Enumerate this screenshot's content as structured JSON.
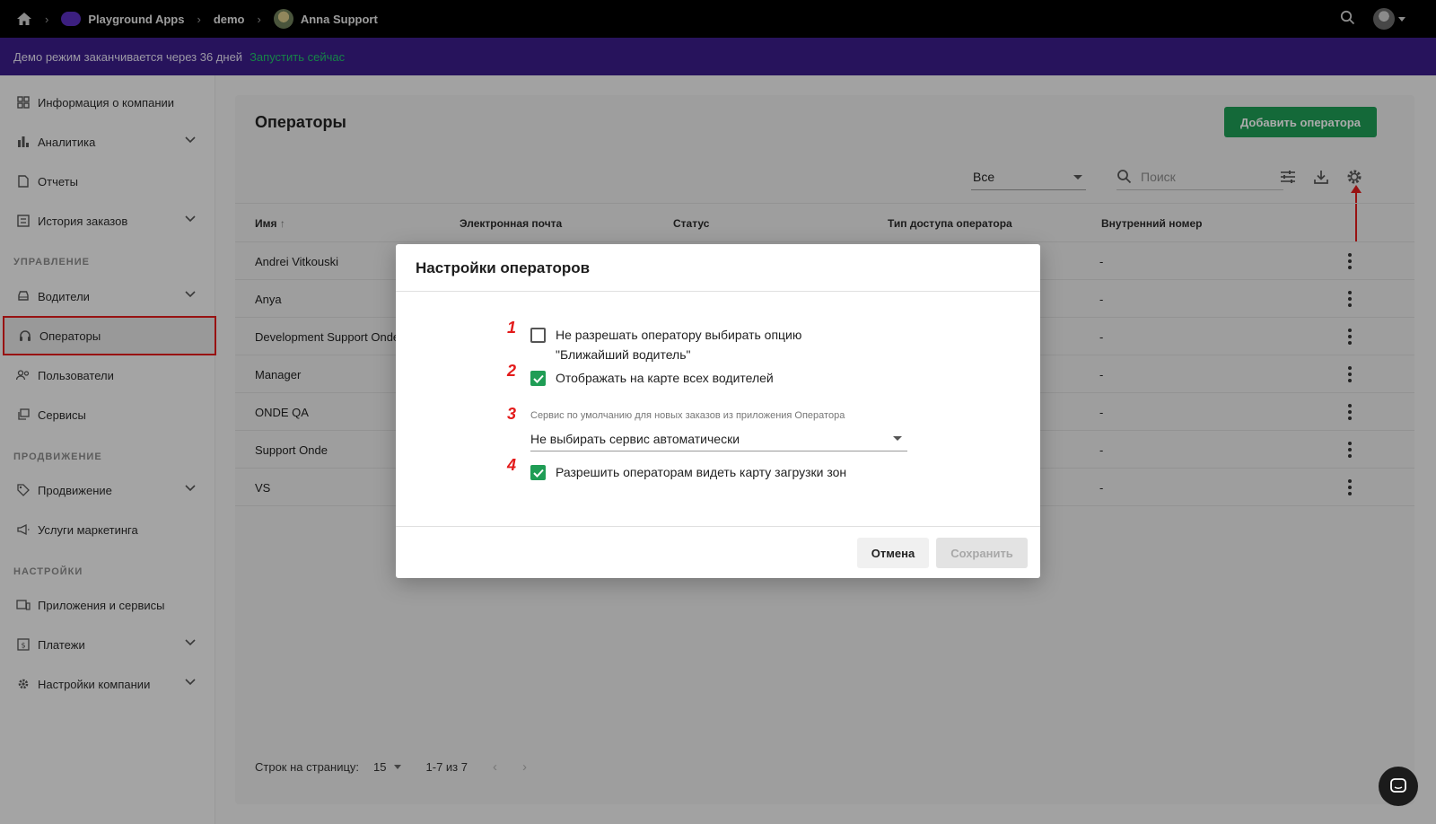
{
  "topbar": {
    "breadcrumbs": [
      "Playground Apps",
      "demo",
      "Anna Support"
    ]
  },
  "banner": {
    "text": "Демо режим заканчивается через 36 дней",
    "link": "Запустить сейчас"
  },
  "sidebar": {
    "items": [
      {
        "label": "Информация о компании",
        "icon": "grid-icon"
      },
      {
        "label": "Аналитика",
        "icon": "bar-chart-icon",
        "expandable": true
      },
      {
        "label": "Отчеты",
        "icon": "document-icon"
      },
      {
        "label": "История заказов",
        "icon": "list-icon",
        "expandable": true
      },
      {
        "label": "Водители",
        "icon": "car-icon",
        "expandable": true
      },
      {
        "label": "Операторы",
        "icon": "headset-icon",
        "active": true
      },
      {
        "label": "Пользователи",
        "icon": "users-icon"
      },
      {
        "label": "Сервисы",
        "icon": "layers-icon"
      },
      {
        "label": "Продвижение",
        "icon": "tag-icon",
        "expandable": true
      },
      {
        "label": "Услуги маркетинга",
        "icon": "megaphone-icon"
      },
      {
        "label": "Приложения и сервисы",
        "icon": "devices-icon"
      },
      {
        "label": "Платежи",
        "icon": "payment-icon",
        "expandable": true
      },
      {
        "label": "Настройки компании",
        "icon": "gear-icon",
        "expandable": true
      }
    ],
    "sections": [
      "УПРАВЛЕНИЕ",
      "ПРОДВИЖЕНИЕ",
      "НАСТРОЙКИ"
    ]
  },
  "main": {
    "title": "Операторы",
    "add_button": "Добавить оператора",
    "filter_value": "Все",
    "search_placeholder": "Поиск",
    "columns": [
      "Имя",
      "Электронная почта",
      "Статус",
      "Тип доступа оператора",
      "Внутренний номер"
    ],
    "rows": [
      {
        "name": "Andrei Vitkouski",
        "ext": "-"
      },
      {
        "name": "Anya",
        "ext": "-"
      },
      {
        "name": "Development Support Onde",
        "ext": "-"
      },
      {
        "name": "Manager",
        "ext": "-"
      },
      {
        "name": "ONDE QA",
        "ext": "-"
      },
      {
        "name": "Support Onde",
        "ext": "-"
      },
      {
        "name": "VS",
        "ext": "-"
      }
    ],
    "pager": {
      "rows_per_page_label": "Строк на страницу:",
      "rows_per_page": "15",
      "range": "1-7 из 7"
    }
  },
  "modal": {
    "title": "Настройки операторов",
    "option1": {
      "num": "1",
      "label_line1": "Не разрешать оператору выбирать опцию",
      "label_line2": "\"Ближайший водитель\"",
      "checked": false
    },
    "option2": {
      "num": "2",
      "label": "Отображать на карте всех водителей",
      "checked": true
    },
    "option3": {
      "num": "3",
      "label": "Сервис по умолчанию для новых заказов из приложения Оператора",
      "value": "Не выбирать сервис автоматически"
    },
    "option4": {
      "num": "4",
      "label": "Разрешить операторам видеть карту загрузки зон",
      "checked": true
    },
    "cancel": "Отмена",
    "save": "Сохранить"
  },
  "colors": {
    "accent_green": "#1f9d55",
    "banner_purple": "#3b1d8a",
    "annotation_red": "#e31b1b"
  }
}
